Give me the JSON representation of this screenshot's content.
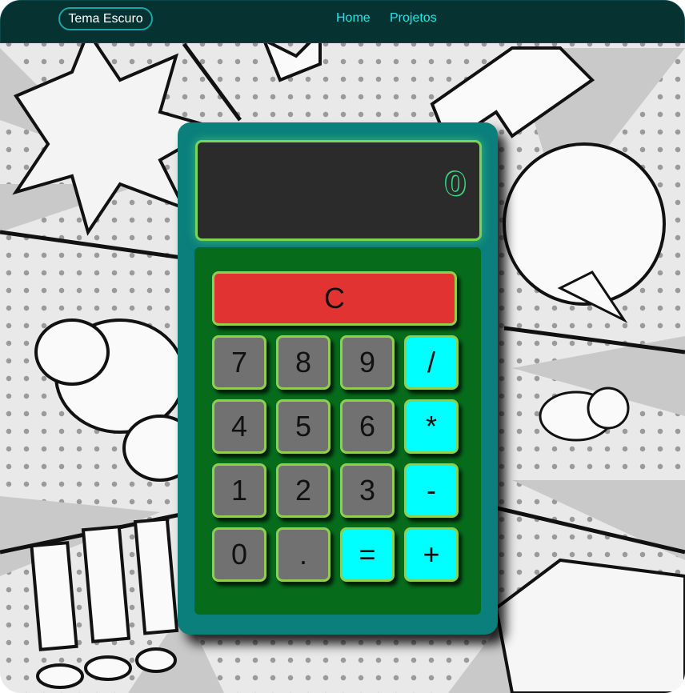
{
  "nav": {
    "theme_button": "Tema Escuro",
    "links": [
      "Home",
      "Projetos"
    ]
  },
  "calculator": {
    "display": "0",
    "clear": "C",
    "keys": {
      "k7": "7",
      "k8": "8",
      "k9": "9",
      "div": "/",
      "k4": "4",
      "k5": "5",
      "k6": "6",
      "mul": "*",
      "k1": "1",
      "k2": "2",
      "k3": "3",
      "sub": "-",
      "k0": "0",
      "dot": ".",
      "eq": "=",
      "add": "+"
    }
  },
  "colors": {
    "nav_bg": "#063232",
    "nav_link": "#1de9e6",
    "calc_body": "#0a7f7c",
    "keypad_bg": "#066b1a",
    "display_bg": "#2b2b2b",
    "display_border": "#7bd454",
    "number_key": "#717171",
    "operator_key": "#00ffff",
    "clear_key": "#e23333"
  }
}
